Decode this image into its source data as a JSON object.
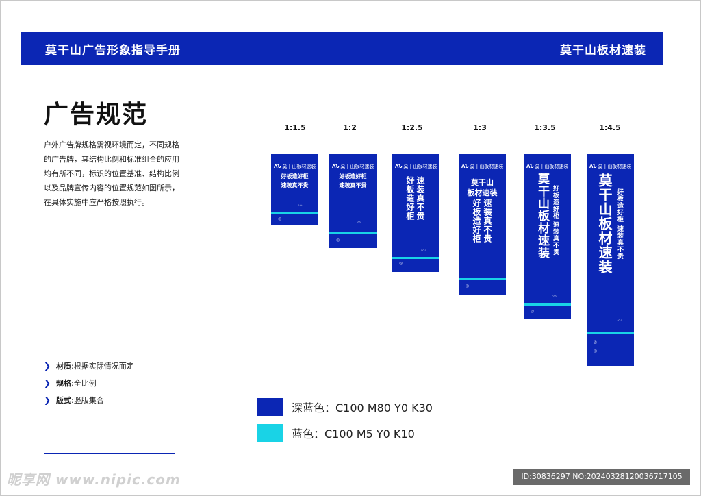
{
  "header": {
    "left_title": "莫干山广告形象指导手册",
    "right_title": "莫干山板材速装"
  },
  "page_title": "广告规范",
  "description": "户外广告牌规格需视环境而定，不同规格的广告牌，其结构比例和标准组合的应用均有所不同，标识的位置基准、结构比例以及品牌宣传内容的位置规范如图所示，在具体实施中应严格按照执行。",
  "specs": [
    {
      "label": "材质",
      "value": ":根据实际情况而定"
    },
    {
      "label": "规格",
      "value": ":全比例"
    },
    {
      "label": "版式",
      "value": ":竖版集合"
    }
  ],
  "ratios": [
    "1:1.5",
    "1:2",
    "1:2.5",
    "1:3",
    "1:3.5",
    "1:4.5"
  ],
  "panel": {
    "brand": "莫干山板材速装",
    "slogan1": "好板造好柜",
    "slogan2": "速装真不贵",
    "vslogan1": "好板造好柜",
    "vslogan2": "速装真不贵",
    "brand_line1": "莫干山",
    "brand_line2": "板材速装",
    "brand_big": "莫干山板材速装"
  },
  "legend": [
    {
      "label": "深蓝色：C100 M80 Y0 K30",
      "color": "#0b26b4"
    },
    {
      "label": "蓝色：C100 M5 Y0 K10",
      "color": "#19d3e6"
    }
  ],
  "watermark": {
    "site": "昵享网 www.nipic.com",
    "id": "ID:30836297 NO:20240328120036717105"
  },
  "colors": {
    "dark_blue": "#0b26b4",
    "cyan": "#19d3e6"
  }
}
